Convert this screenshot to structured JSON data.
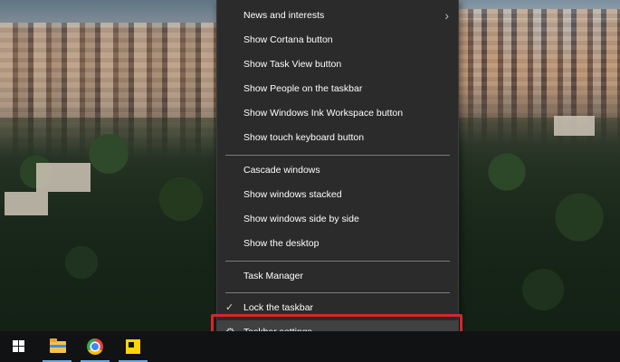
{
  "context_menu": {
    "items": [
      {
        "id": "news",
        "label": "News and interests",
        "submenu": true
      },
      {
        "id": "cortana",
        "label": "Show Cortana button"
      },
      {
        "id": "taskview",
        "label": "Show Task View button"
      },
      {
        "id": "people",
        "label": "Show People on the taskbar"
      },
      {
        "id": "ink",
        "label": "Show Windows Ink Workspace button"
      },
      {
        "id": "keyboard",
        "label": "Show touch keyboard button"
      },
      {
        "id": "cascade",
        "label": "Cascade windows"
      },
      {
        "id": "stacked",
        "label": "Show windows stacked"
      },
      {
        "id": "sidebyside",
        "label": "Show windows side by side"
      },
      {
        "id": "desktop",
        "label": "Show the desktop"
      },
      {
        "id": "taskmanager",
        "label": "Task Manager"
      },
      {
        "id": "lock",
        "label": "Lock the taskbar",
        "checked": true
      },
      {
        "id": "settings",
        "label": "Taskbar settings"
      }
    ],
    "icons": {
      "submenu": "chevron-right-icon",
      "check": "checkmark-icon",
      "settings": "gear-icon"
    }
  },
  "taskbar": {
    "buttons": [
      "windows-start",
      "file-explorer",
      "google-chrome",
      "sticky-notes"
    ]
  },
  "colors": {
    "menu_bg": "#2b2b2b",
    "highlight_border": "#d6262b",
    "taskbar_bg": "#111214"
  }
}
